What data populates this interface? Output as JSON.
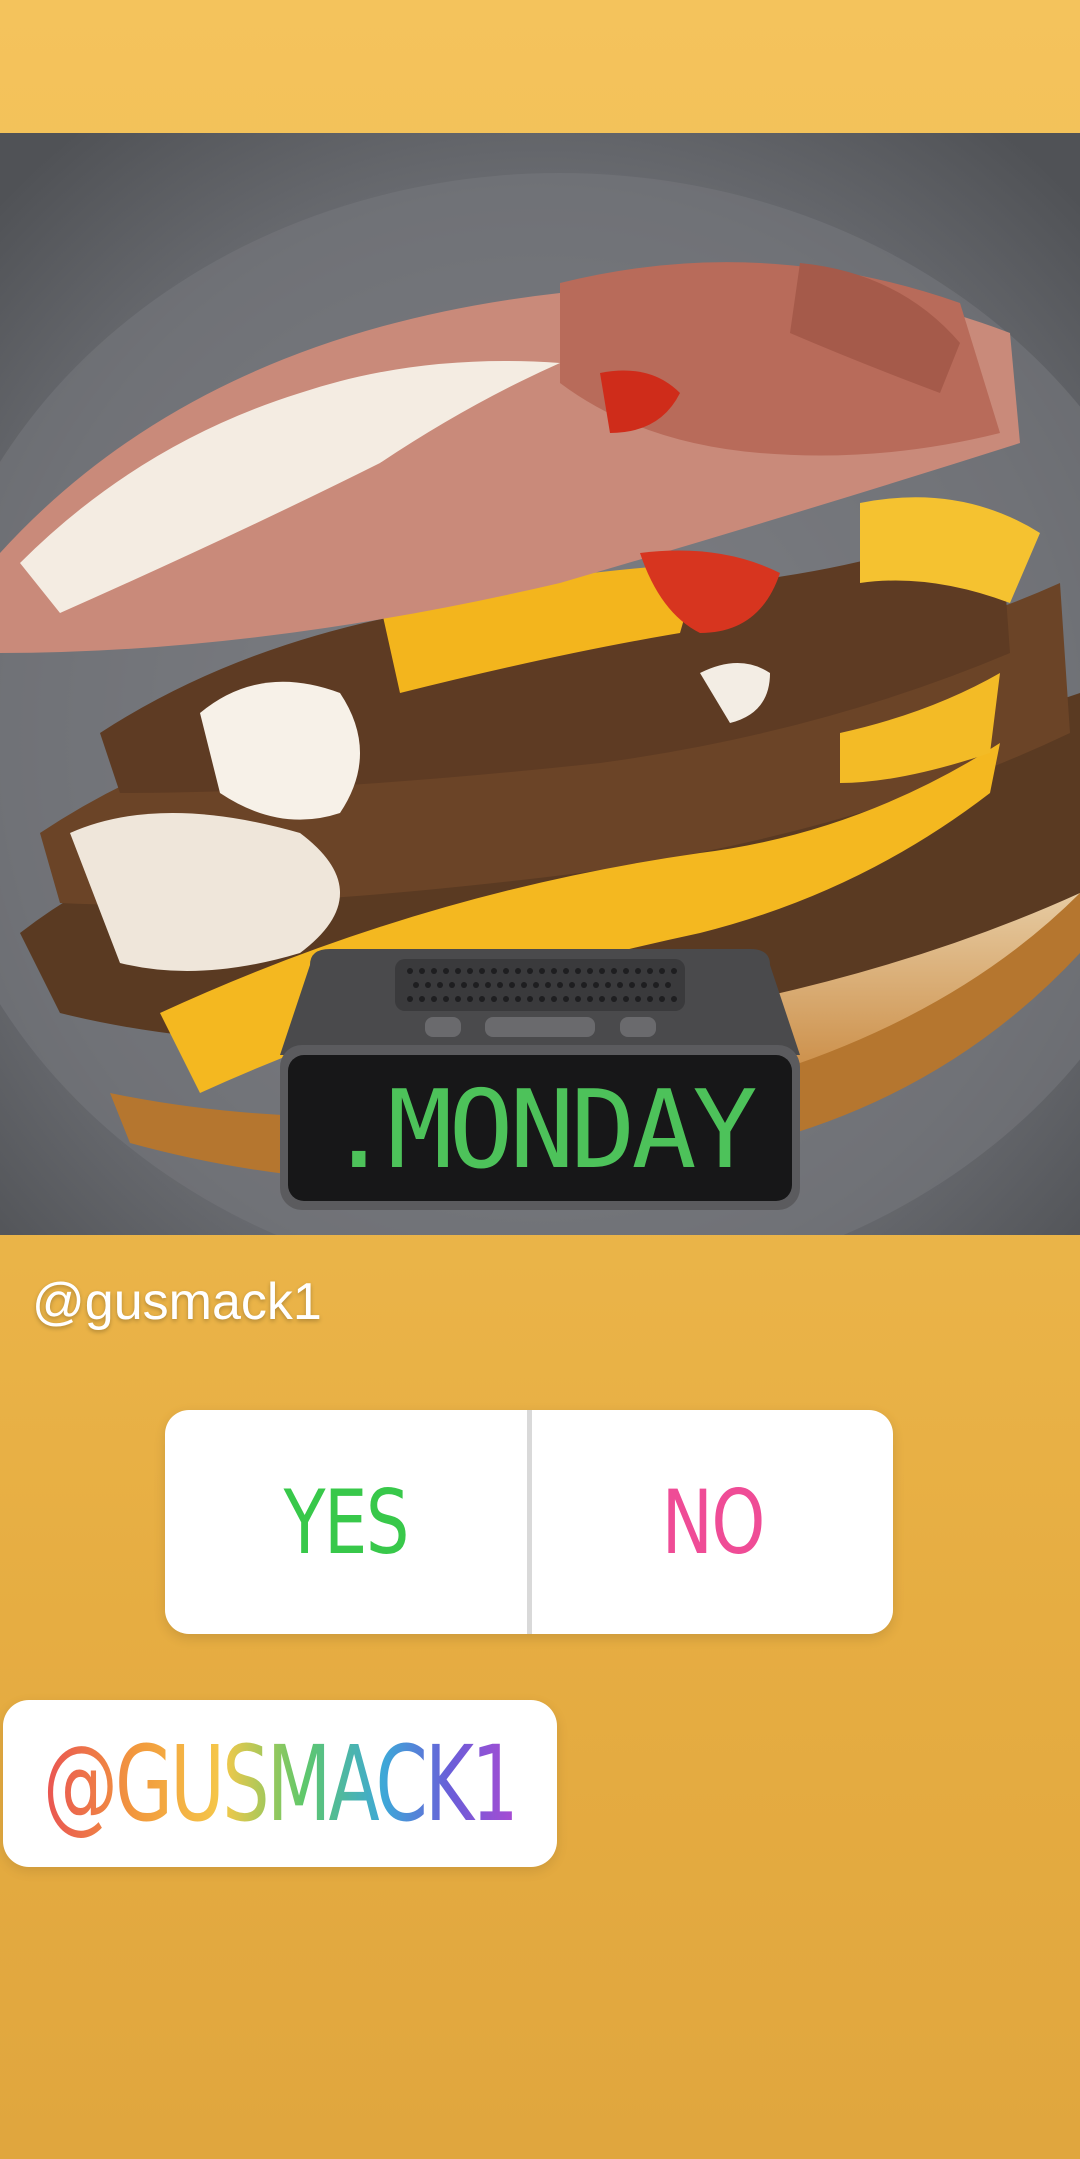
{
  "story": {
    "username": "@gusmack1",
    "clock_sticker_text": ".MONDAY",
    "poll": {
      "yes_label": "YES",
      "no_label": "NO",
      "yes_color": "#38c84a",
      "no_color": "#ef4c96"
    },
    "mention_sticker": "@GUSMACK1",
    "background_color": "#eab54a"
  },
  "icons": [
    "clock-sticker-icon"
  ]
}
